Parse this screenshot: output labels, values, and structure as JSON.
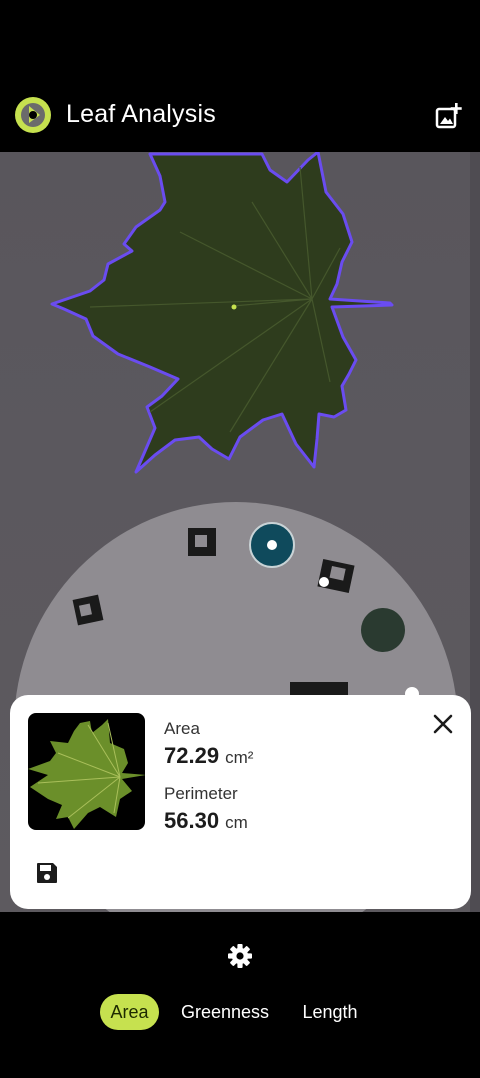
{
  "app": {
    "title": "Leaf Analysis",
    "accent_color": "#c6e14f",
    "icons": {
      "logo": "leaf-logo-icon",
      "add_photo": "add-photo-icon"
    }
  },
  "camera_view": {
    "contour_color": "#6a4cf0",
    "description_icons": [
      "leaf-contour",
      "calibration-disk"
    ]
  },
  "result_card": {
    "area": {
      "label": "Area",
      "value": "72.29",
      "unit": "cm²"
    },
    "perimeter": {
      "label": "Perimeter",
      "value": "56.30",
      "unit": "cm"
    },
    "icons": {
      "close": "close-icon",
      "save": "save-icon"
    }
  },
  "bottom_bar": {
    "settings_icon": "gear-icon",
    "tabs": [
      {
        "label": "Area",
        "active": true
      },
      {
        "label": "Greenness",
        "active": false
      },
      {
        "label": "Length",
        "active": false
      }
    ]
  }
}
